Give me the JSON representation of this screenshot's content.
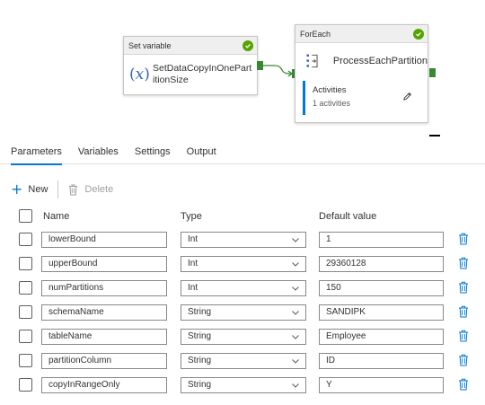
{
  "pipeline": {
    "set_variable": {
      "type_label": "Set variable",
      "activity_name": "SetDataCopyInOnePartitionSize",
      "icon": "variable-x-icon",
      "status": "succeeded"
    },
    "foreach": {
      "type_label": "ForEach",
      "activity_name": "ProcessEachPartition",
      "icon": "foreach-icon",
      "status": "succeeded",
      "activities_label": "Activities",
      "activities_count": "1 activities"
    }
  },
  "tabs": [
    {
      "label": "Parameters",
      "active": true
    },
    {
      "label": "Variables",
      "active": false
    },
    {
      "label": "Settings",
      "active": false
    },
    {
      "label": "Output",
      "active": false
    }
  ],
  "toolbar": {
    "new_label": "New",
    "delete_label": "Delete"
  },
  "grid": {
    "columns": {
      "name": "Name",
      "type": "Type",
      "default": "Default value"
    },
    "rows": [
      {
        "name": "lowerBound",
        "type": "Int",
        "default": "1"
      },
      {
        "name": "upperBound",
        "type": "Int",
        "default": "29360128"
      },
      {
        "name": "numPartitions",
        "type": "Int",
        "default": "150"
      },
      {
        "name": "schemaName",
        "type": "String",
        "default": "SANDIPK"
      },
      {
        "name": "tableName",
        "type": "String",
        "default": "Employee"
      },
      {
        "name": "partitionColumn",
        "type": "String",
        "default": "ID"
      },
      {
        "name": "copyInRangeOnly",
        "type": "String",
        "default": "Y"
      }
    ]
  },
  "colors": {
    "accent": "#0078d4",
    "success": "#57a300",
    "connector": "#378931"
  }
}
